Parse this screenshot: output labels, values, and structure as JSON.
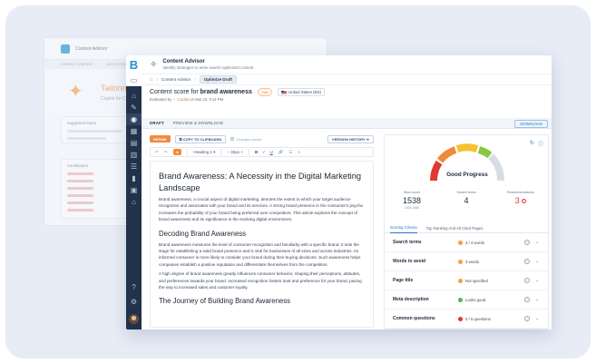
{
  "background_window": {
    "title": "Content Advisor",
    "subtitle": "Identify strategies to write search-optimized content",
    "tabs": [
      "CREATE CONTENT",
      "SAVED DRAFTS",
      "RESEARCH TOPIC"
    ],
    "hero_title": "Tailored co",
    "hero_subtitle": "Copilot for Con",
    "suggested_topics_label": "Suggested topics",
    "contributors_label": "Contributors"
  },
  "app": {
    "logo": "B",
    "title": "Content Advisor",
    "subtitle": "Identify strategies to write search-optimized content"
  },
  "breadcrumb": {
    "home": "⌂",
    "item1": "Content Advisor",
    "item2": "Optimize Draft",
    "sep": "/"
  },
  "score": {
    "prefix": "Content score for",
    "keyword": "brand awareness",
    "badge": "Hot",
    "locale": "United States (EN)",
    "evaluated_by_prefix": "Evaluated by",
    "evaluator": "Copilot",
    "evaluated_on": "on Mar 22, 9:14 PM"
  },
  "tabs": {
    "draft": "DRAFT",
    "preview": "PREVIEW & DOWNLOAD",
    "download": "DOWNLOAD"
  },
  "editor_toolbar": {
    "refine": "REFINE",
    "copy": "COPY TO CLIPBOARD",
    "saved": "Changes saved",
    "version": "VERSION HISTORY",
    "ai": "AI",
    "heading": "Heading 1",
    "font_size": "32px",
    "bold": "B",
    "italic": "I",
    "underline": "U",
    "link": "🔗",
    "undo": "↶",
    "redo": "↷"
  },
  "document": {
    "h1": "Brand Awareness: A Necessity in the Digital Marketing Landscape",
    "p1": "Brand awareness, a crucial aspect of digital marketing, denotes the extent to which your target audience recognizes and associates with your brand and its services. A strong brand presence in the consumer's psyche increases the probability of your brand being preferred over competitors. This article explores the concept of brand awareness and its significance in the evolving digital environment.",
    "h2a": "Decoding Brand Awareness",
    "p2": "Brand awareness measures the level of consumer recognition and familiarity with a specific brand. It sets the stage for establishing a solid brand presence and is vital for businesses of all sizes and across industries. An informed consumer is more likely to consider your brand during their buying decisions. Such awareness helps companies establish a positive reputation and differentiate themselves from the competition.",
    "p3": "A high degree of brand awareness greatly influences consumer behavior, shaping their perceptions, attitudes, and preferences towards your brand. Increased recognition fosters trust and preference for your brand, paving the way to increased sales and customer loyalty.",
    "h2b": "The Journey of Building Brand Awareness"
  },
  "panel": {
    "gauge_label": "Good Progress",
    "gauge_level": 0.72,
    "stats": [
      {
        "label": "Word count",
        "value": "1538",
        "sub": "1406-1683"
      },
      {
        "label": "Search terms",
        "value": "4",
        "sub": ""
      },
      {
        "label": "Recommendations",
        "value": "3",
        "sub": ""
      }
    ],
    "tab1": "Scoring Criteria",
    "tab2": "Top Ranking And All Cited Pages",
    "criteria": [
      {
        "name": "Search terms",
        "status": "3 / 4 words",
        "color": "#f0a33a"
      },
      {
        "name": "Words to avoid",
        "status": "3 words",
        "color": "#f0a33a"
      },
      {
        "name": "Page title",
        "status": "Not specified",
        "color": "#f0a33a"
      },
      {
        "name": "Meta description",
        "status": "Looks good",
        "color": "#4bb36b"
      },
      {
        "name": "Common questions",
        "status": "0 / 5 questions",
        "color": "#e0392f"
      }
    ]
  },
  "colors": {
    "accent": "#2190d8",
    "orange": "#f08a3c",
    "sidebar": "#21324a"
  }
}
